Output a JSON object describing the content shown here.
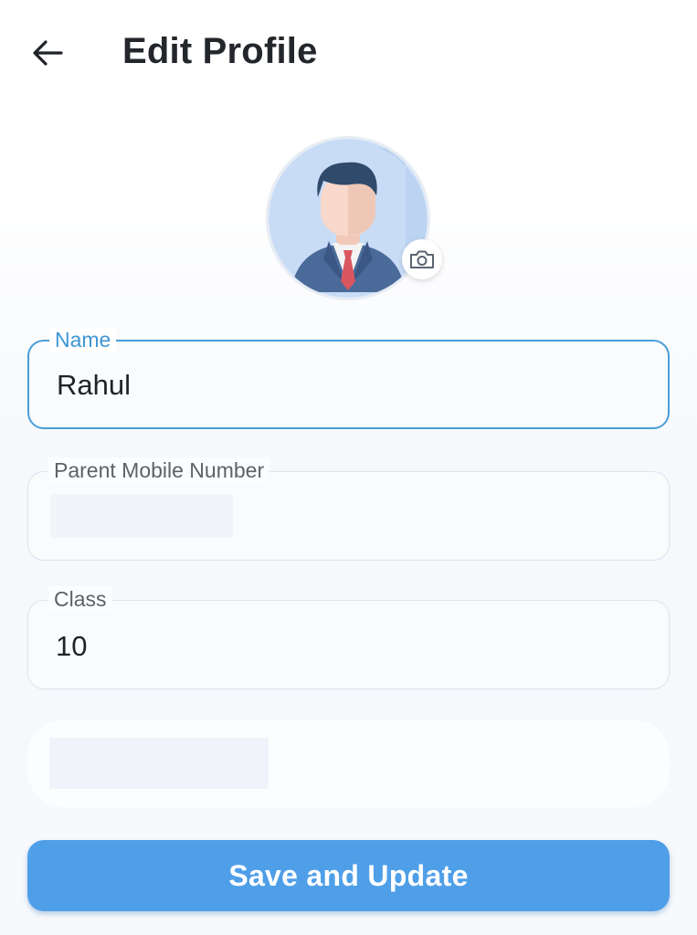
{
  "header": {
    "title": "Edit Profile",
    "back_icon": "arrow-left-icon"
  },
  "avatar": {
    "icon": "businessman-avatar-icon",
    "camera_icon": "camera-icon"
  },
  "form": {
    "name": {
      "label": "Name",
      "value": "Rahul"
    },
    "mobile": {
      "label": "Parent Mobile Number"
    },
    "class": {
      "label": "Class",
      "value": "10"
    }
  },
  "actions": {
    "save_label": "Save and Update"
  },
  "colors": {
    "accent": "#4f9fe8",
    "focused_border": "#4a9dd8",
    "focused_label": "#3f95d3"
  }
}
